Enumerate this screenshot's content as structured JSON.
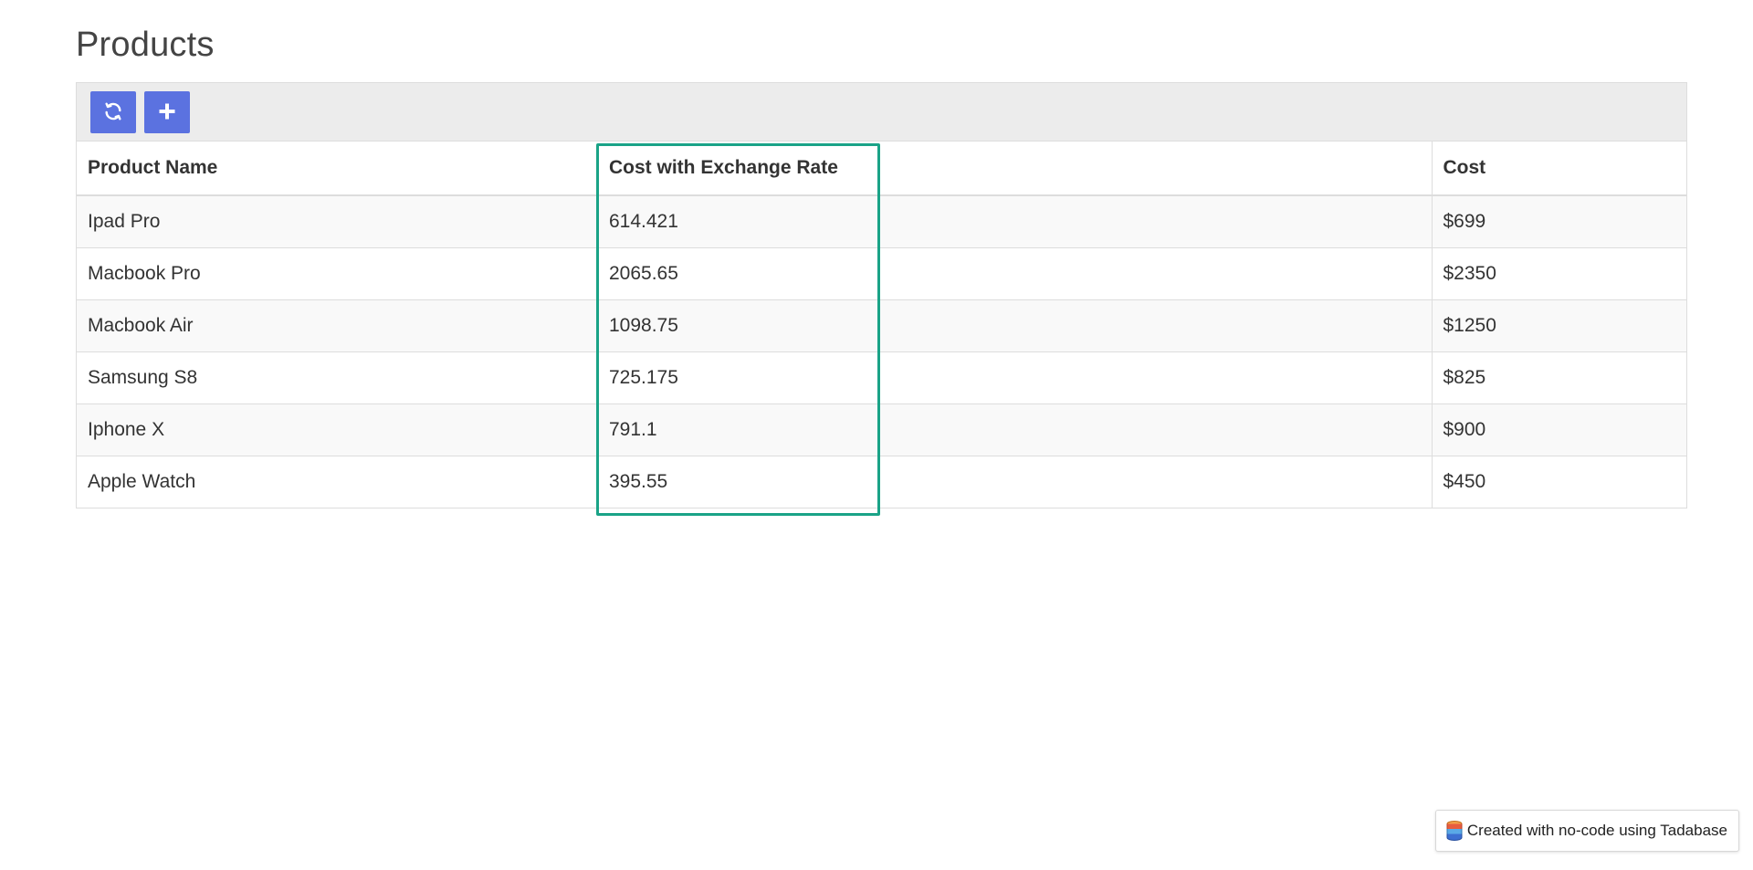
{
  "page": {
    "title": "Products"
  },
  "toolbar": {
    "refresh_icon": "refresh-icon",
    "add_icon": "plus-icon",
    "button_color": "#5b72e0"
  },
  "table": {
    "columns": [
      "Product Name",
      "Cost with Exchange Rate",
      "Cost"
    ],
    "rows": [
      {
        "name": "Ipad Pro",
        "rate": "614.421",
        "cost": "$699"
      },
      {
        "name": "Macbook Pro",
        "rate": "2065.65",
        "cost": "$2350"
      },
      {
        "name": "Macbook Air",
        "rate": "1098.75",
        "cost": "$1250"
      },
      {
        "name": "Samsung S8",
        "rate": "725.175",
        "cost": "$825"
      },
      {
        "name": "Iphone X",
        "rate": "791.1",
        "cost": "$900"
      },
      {
        "name": "Apple Watch",
        "rate": "395.55",
        "cost": "$450"
      }
    ]
  },
  "highlight": {
    "color": "#1aa387"
  },
  "footer": {
    "badge_text": "Created with no-code using Tadabase",
    "badge_icon": "database-icon"
  }
}
